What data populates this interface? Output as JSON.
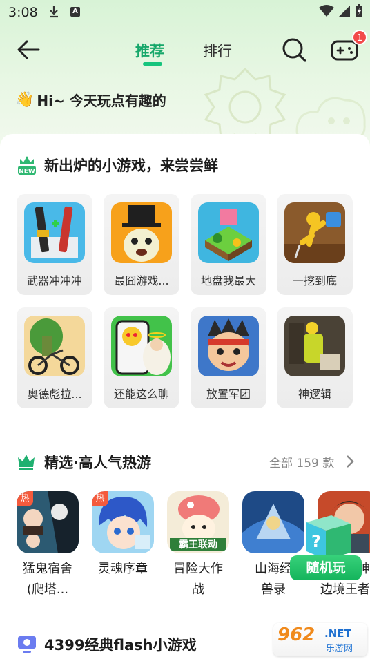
{
  "status_bar": {
    "time": "3:08",
    "account_letter": "A"
  },
  "header": {
    "tabs": [
      {
        "label": "推荐",
        "active": true
      },
      {
        "label": "排行",
        "active": false
      }
    ],
    "notification_count": "1"
  },
  "greeting": {
    "emoji": "👋",
    "text": "Hi~ 今天玩点有趣的"
  },
  "new_games": {
    "badge": "NEW",
    "title": "新出炉的小游戏，来尝尝鲜",
    "items": [
      {
        "name": "武器冲冲冲"
      },
      {
        "name": "最囧游戏..."
      },
      {
        "name": "地盘我最大"
      },
      {
        "name": "一挖到底"
      },
      {
        "name": "奥德彪拉..."
      },
      {
        "name": "还能这么聊"
      },
      {
        "name": "放置军团"
      },
      {
        "name": "神逻辑"
      }
    ]
  },
  "hot_games": {
    "title": "精选·高人气热游",
    "more_label": "全部 159 款",
    "items": [
      {
        "name_line1": "猛鬼宿舍",
        "name_line2": "(爬塔...",
        "tag": "热"
      },
      {
        "name_line1": "灵魂序章",
        "name_line2": "",
        "tag": "热"
      },
      {
        "name_line1": "冒险大作",
        "name_line2": "战",
        "tag": "",
        "art_text": "霸王联动"
      },
      {
        "name_line1": "山海经",
        "name_line2": "兽录",
        "tag": ""
      },
      {
        "name_line1": "神",
        "name_line2": "边境王者",
        "tag": ""
      }
    ]
  },
  "random_play": {
    "label": "随机玩",
    "cube_mark": "?"
  },
  "flash_section": {
    "title": "4399经典flash小游戏"
  },
  "watermark": {
    "number": "962",
    "net": ".NET",
    "site": "乐游网"
  },
  "colors": {
    "accent": "#16a76a",
    "badge": "#f24a4a",
    "hot_tag": "#f45a3c"
  }
}
